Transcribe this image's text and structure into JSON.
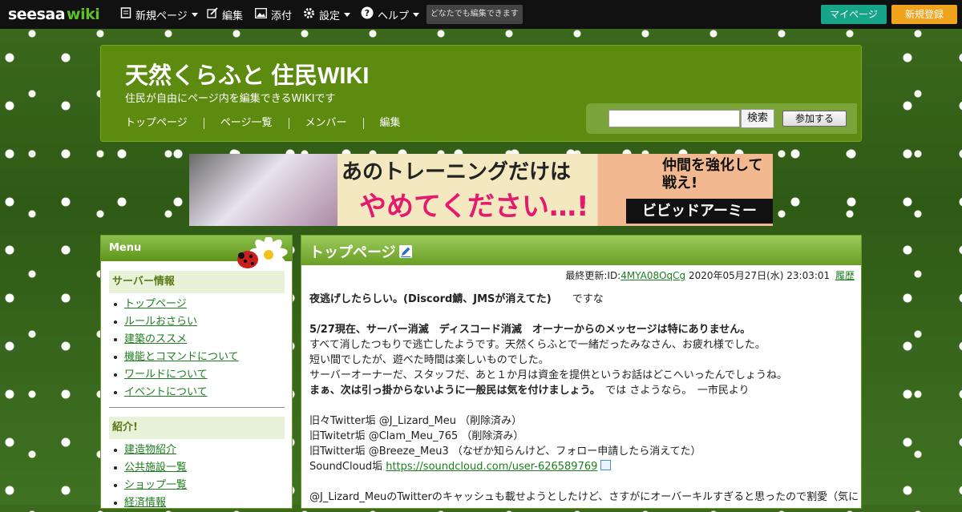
{
  "topbar": {
    "logo_a": "seesaa",
    "logo_b": "wiki",
    "menu": [
      {
        "label": "新規ページ",
        "icon": "new-page-icon",
        "has_caret": true
      },
      {
        "label": "編集",
        "icon": "edit-icon",
        "has_caret": false
      },
      {
        "label": "添付",
        "icon": "image-icon",
        "has_caret": false
      },
      {
        "label": "設定",
        "icon": "gear-icon",
        "has_caret": true
      },
      {
        "label": "ヘルプ",
        "icon": "help-icon",
        "has_caret": true
      }
    ],
    "anyone_badge": "どなたでも編集できます",
    "mypage": "マイページ",
    "register": "新規登録"
  },
  "header": {
    "title": "天然くらふと 住民WIKI",
    "subtitle": "住民が自由にページ内を編集できるWIKIです",
    "nav": [
      "トップページ",
      "ページ一覧",
      "メンバー",
      "編集"
    ],
    "search_button": "検索",
    "join_button": "参加する"
  },
  "banner": {
    "line1": "あのトレーニングだけは",
    "line2": "やめてください…!",
    "side_text": "仲間を強化して戦え!",
    "brand": "ビビッドアーミー"
  },
  "sidebar": {
    "title": "Menu",
    "sections": [
      {
        "heading": "サーバー情報",
        "items": [
          "トップページ",
          "ルールおさらい",
          "建築のススメ",
          "機能とコマンドについて",
          "ワールドについて",
          "イベントについて"
        ]
      },
      {
        "heading": "紹介!",
        "items": [
          "建造物紹介",
          "公共施設一覧",
          "ショップ一覧",
          "経済情報"
        ]
      }
    ]
  },
  "main": {
    "page_title": "トップページ",
    "meta_prefix": "最終更新:ID:",
    "meta_id": "4MYA08OqCg",
    "meta_date": "2020年05月27日(水) 23:03:01",
    "history": "履歴",
    "lines": [
      {
        "bold": "夜逃げしたらしい。(Discord鯖、JMSが消えてた)",
        "text": "　　ですな"
      },
      {
        "gap": true
      },
      {
        "bold": "5/27現在、サーバー消滅　ディスコード消滅　オーナーからのメッセージは特にありません。",
        "text": ""
      },
      {
        "text": "すべて消したつもりで逃亡したようです。天然くらふとで一緒だったみなさん、お疲れ様でした。"
      },
      {
        "text": "短い間でしたが、遊べた時間は楽しいものでした。"
      },
      {
        "text": "サーバーオーナーだ、スタッフだ、あと１か月は資金を提供というお話はどこへいったんでしょうね。"
      },
      {
        "bold": "まぁ、次は引っ掛からないように一般民は気を付けましょう。",
        "text": "　では さようなら。　一市民より"
      },
      {
        "gap": true
      },
      {
        "text": "旧々Twitter垢 @J_Lizard_Meu （削除済み）"
      },
      {
        "text": "旧Twitetr垢 @Clam_Meu_765 （削除済み）"
      },
      {
        "text": "旧Twitter垢 @Breeze_Meu3 （なぜか知らんけど、フォロー申請したら消えてた）"
      },
      {
        "text": "SoundCloud垢 ",
        "link": "https://soundcloud.com/user-626589769"
      },
      {
        "gap": true
      },
      {
        "text": "@J_Lizard_MeuのTwitterのキャッシュも載せようとしたけど、さすがにオーバーキルすぎると思ったので割愛（気に"
      }
    ]
  },
  "colors": {
    "header_green": "#5d8b0f",
    "link_green": "#1e7d1e",
    "mypage": "#17a589",
    "register": "#f0a31c"
  }
}
